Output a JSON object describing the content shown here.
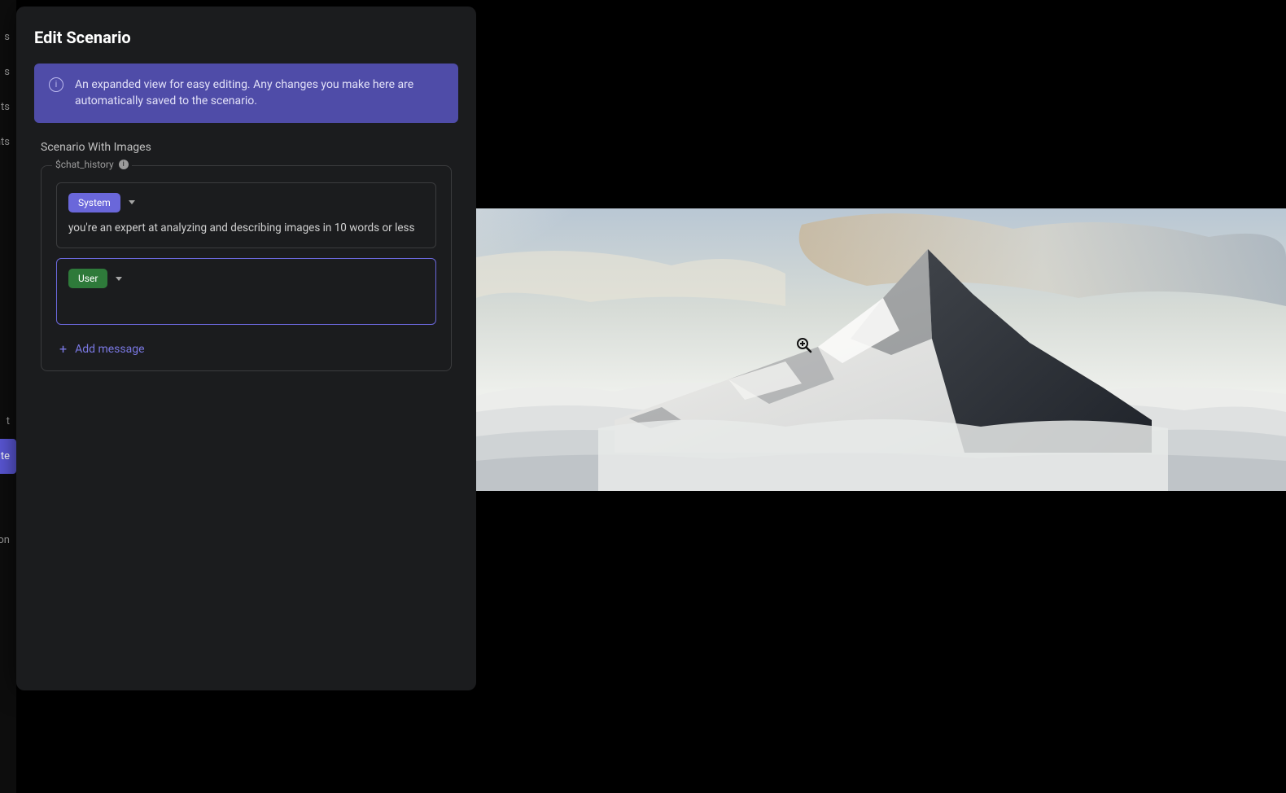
{
  "panel": {
    "title": "Edit Scenario",
    "info_text": "An expanded view for easy editing. Any changes you make here are automatically saved to the scenario.",
    "section_label": "Scenario With Images",
    "chat_var": "$chat_history",
    "messages": [
      {
        "role": "System",
        "text": "you're an expert at analyzing and describing images in 10 words or less"
      },
      {
        "role": "User",
        "text": ""
      }
    ],
    "add_message_label": "Add message"
  },
  "sidebar": {
    "items": [
      "s",
      "s",
      "ts",
      "nts",
      "t",
      "te",
      "ion"
    ]
  },
  "image": {
    "description": "Snow-covered mountain peak rising above a sea of clouds under soft sky"
  }
}
